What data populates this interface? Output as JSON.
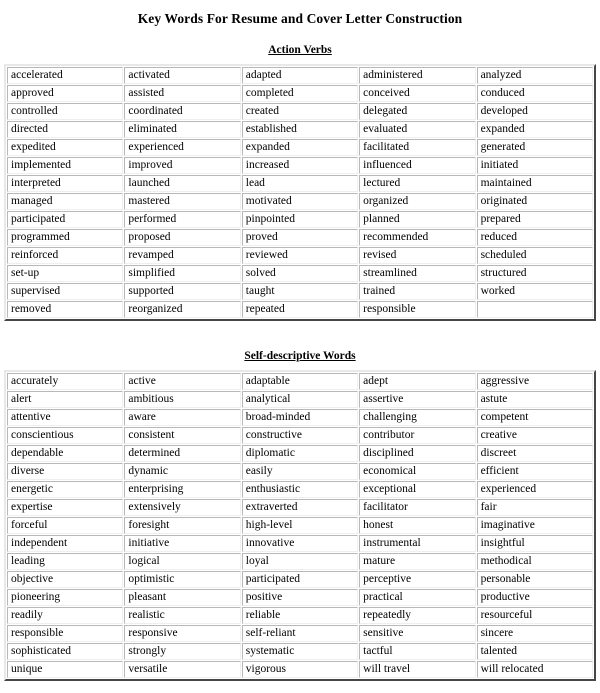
{
  "document": {
    "title": "Key Words For Resume and Cover Letter Construction"
  },
  "sections": [
    {
      "heading": "Action Verbs",
      "columns": 5,
      "rows": [
        [
          "accelerated",
          "activated",
          "adapted",
          "administered",
          "analyzed"
        ],
        [
          "approved",
          "assisted",
          "completed",
          "conceived",
          "conduced"
        ],
        [
          "controlled",
          "coordinated",
          "created",
          "delegated",
          "developed"
        ],
        [
          "directed",
          "eliminated",
          "established",
          "evaluated",
          "expanded"
        ],
        [
          "expedited",
          "experienced",
          "expanded",
          "facilitated",
          "generated"
        ],
        [
          "implemented",
          "improved",
          "increased",
          "influenced",
          "initiated"
        ],
        [
          "interpreted",
          "launched",
          "lead",
          "lectured",
          "maintained"
        ],
        [
          "managed",
          "mastered",
          "motivated",
          "organized",
          "originated"
        ],
        [
          "participated",
          "performed",
          "pinpointed",
          "planned",
          "prepared"
        ],
        [
          "programmed",
          "proposed",
          "proved",
          "recommended",
          "reduced"
        ],
        [
          "reinforced",
          "revamped",
          "reviewed",
          "revised",
          "scheduled"
        ],
        [
          "set-up",
          "simplified",
          "solved",
          "streamlined",
          "structured"
        ],
        [
          "supervised",
          "supported",
          "taught",
          "trained",
          "worked"
        ],
        [
          "removed",
          "reorganized",
          "repeated",
          "responsible",
          ""
        ]
      ]
    },
    {
      "heading": "Self-descriptive Words",
      "columns": 5,
      "rows": [
        [
          "accurately",
          "active",
          "adaptable",
          "adept",
          "aggressive"
        ],
        [
          "alert",
          "ambitious",
          "analytical",
          "assertive",
          "astute"
        ],
        [
          "attentive",
          "aware",
          "broad-minded",
          "challenging",
          "competent"
        ],
        [
          "conscientious",
          "consistent",
          "constructive",
          "contributor",
          "creative"
        ],
        [
          "dependable",
          "determined",
          "diplomatic",
          "disciplined",
          "discreet"
        ],
        [
          "diverse",
          "dynamic",
          "easily",
          "economical",
          "efficient"
        ],
        [
          "energetic",
          "enterprising",
          "enthusiastic",
          "exceptional",
          "experienced"
        ],
        [
          "expertise",
          "extensively",
          "extraverted",
          "facilitator",
          "fair"
        ],
        [
          "forceful",
          "foresight",
          "high-level",
          "honest",
          "imaginative"
        ],
        [
          "independent",
          "initiative",
          "innovative",
          "instrumental",
          "insightful"
        ],
        [
          "leading",
          "logical",
          "loyal",
          "mature",
          "methodical"
        ],
        [
          "objective",
          "optimistic",
          "participated",
          "perceptive",
          "personable"
        ],
        [
          "pioneering",
          "pleasant",
          "positive",
          "practical",
          "productive"
        ],
        [
          "readily",
          "realistic",
          "reliable",
          "repeatedly",
          "resourceful"
        ],
        [
          "responsible",
          "responsive",
          "self-reliant",
          "sensitive",
          "sincere"
        ],
        [
          "sophisticated",
          "strongly",
          "systematic",
          "tactful",
          "talented"
        ],
        [
          "unique",
          "versatile",
          "vigorous",
          "will travel",
          "will relocated"
        ]
      ]
    }
  ]
}
